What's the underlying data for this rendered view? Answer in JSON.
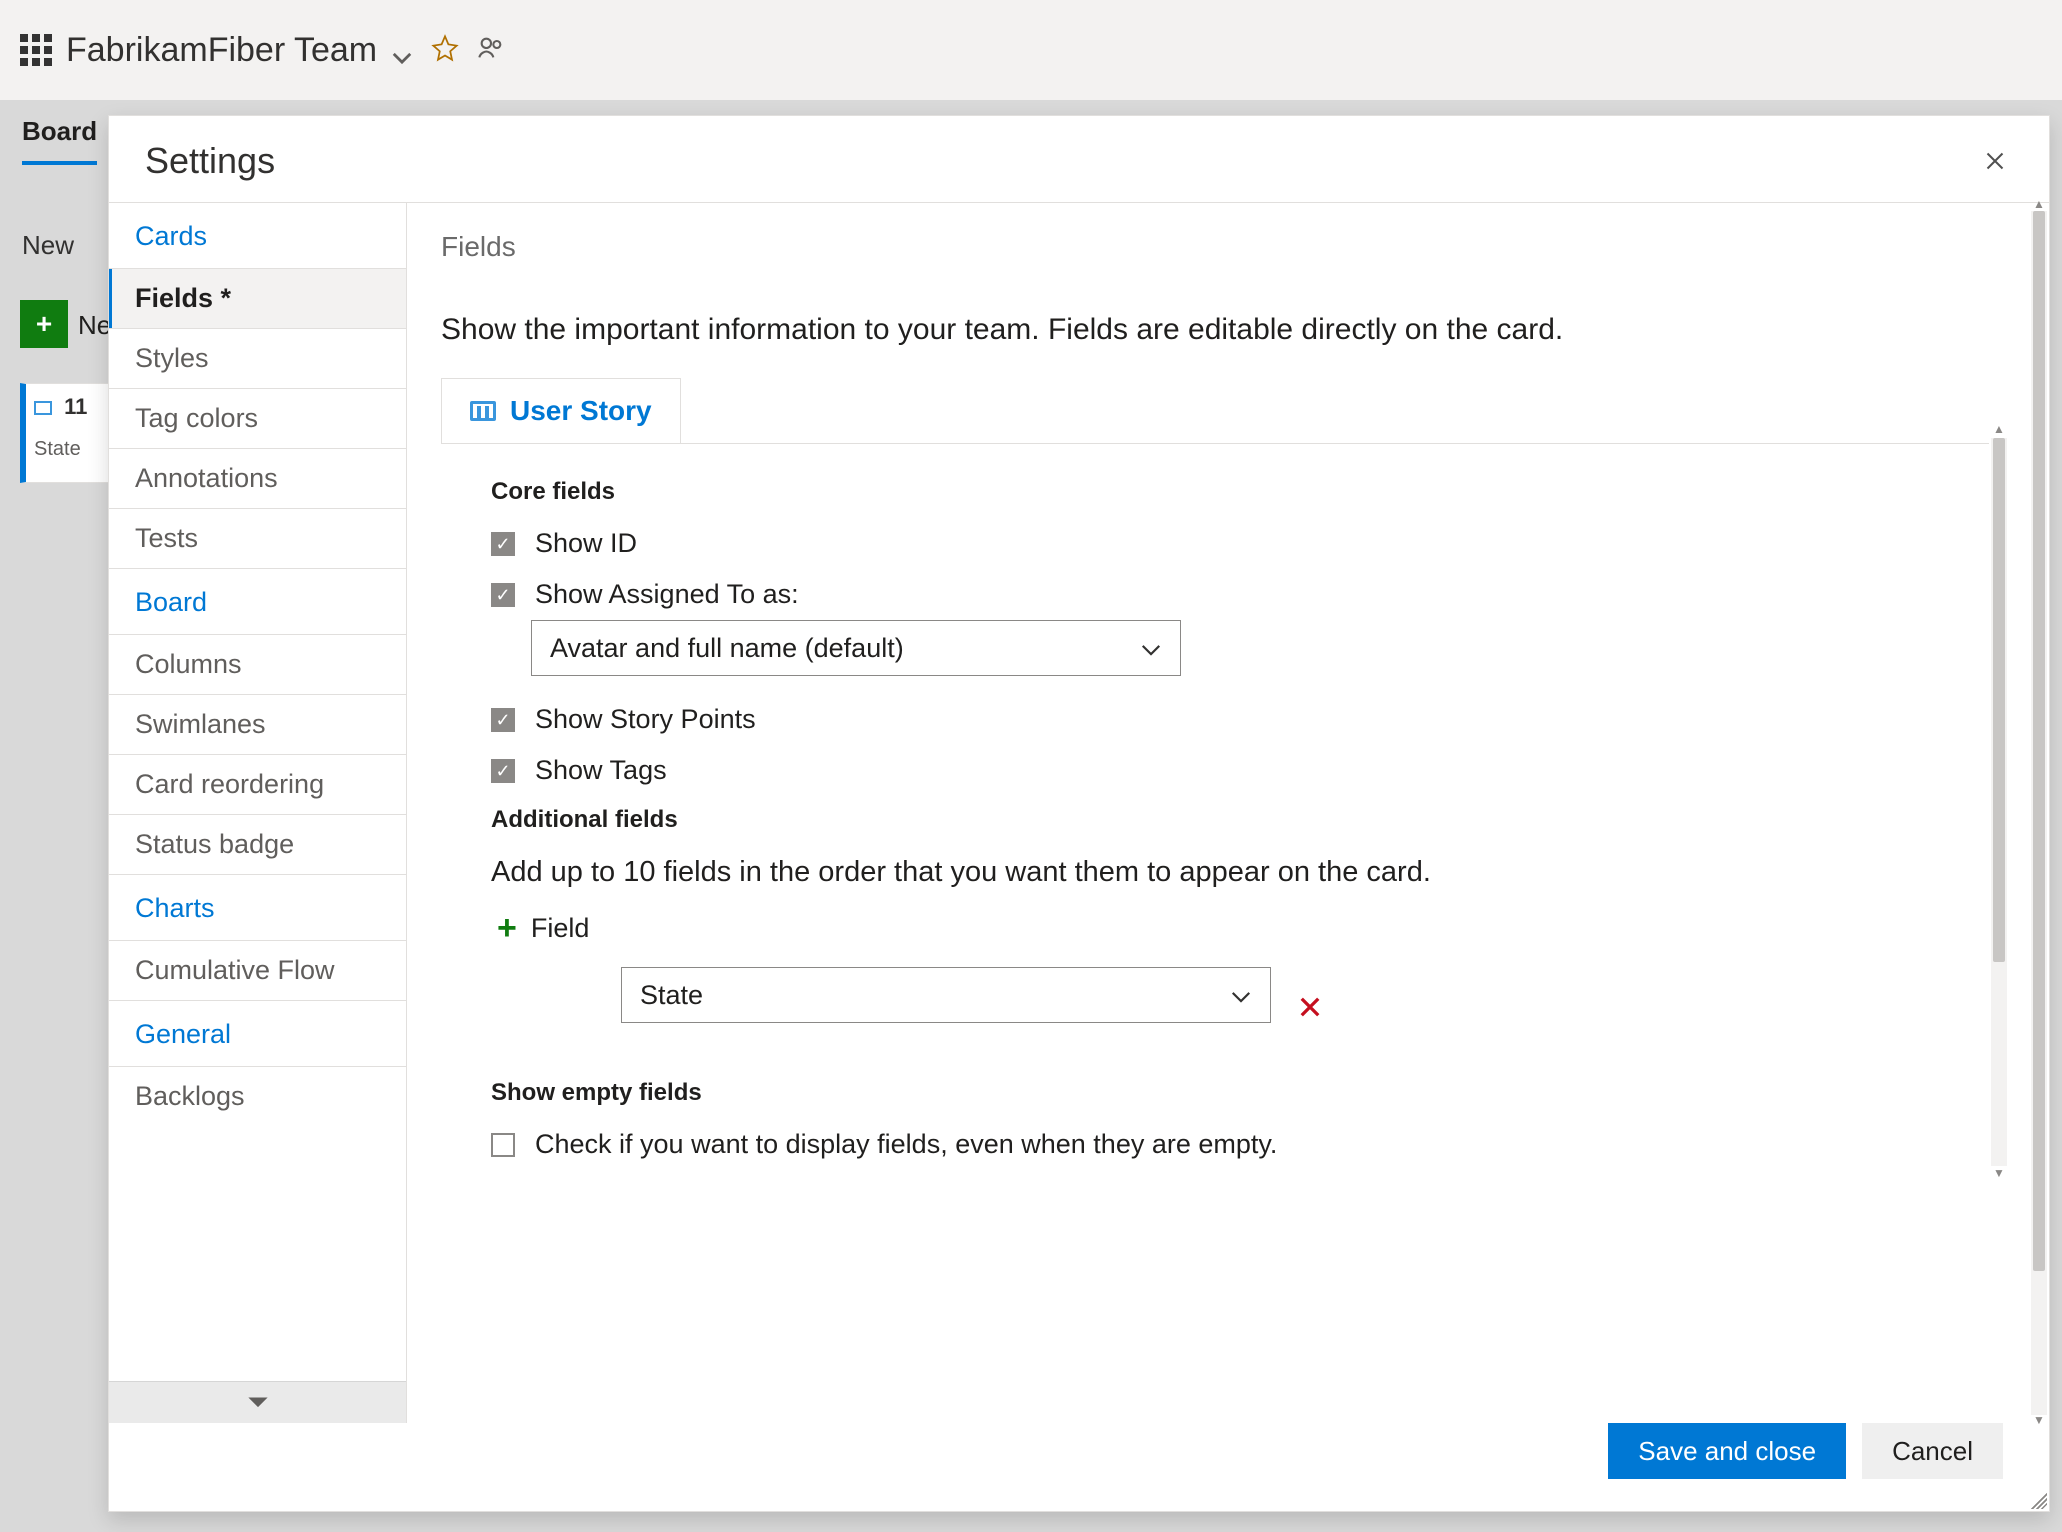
{
  "background": {
    "team_name": "FabrikamFiber Team",
    "tab": "Board",
    "column_new": "New",
    "new_item_label": "Ne",
    "card_id": "11",
    "card_state_label": "State"
  },
  "modal": {
    "title": "Settings",
    "nav": {
      "groups": [
        {
          "header": "Cards",
          "items": [
            {
              "label": "Fields *",
              "active": true
            },
            {
              "label": "Styles"
            },
            {
              "label": "Tag colors"
            },
            {
              "label": "Annotations"
            },
            {
              "label": "Tests"
            }
          ]
        },
        {
          "header": "Board",
          "items": [
            {
              "label": "Columns"
            },
            {
              "label": "Swimlanes"
            },
            {
              "label": "Card reordering"
            },
            {
              "label": "Status badge"
            }
          ]
        },
        {
          "header": "Charts",
          "items": [
            {
              "label": "Cumulative Flow"
            }
          ]
        },
        {
          "header": "General",
          "items": [
            {
              "label": "Backlogs"
            }
          ]
        }
      ]
    },
    "panel": {
      "title": "Fields",
      "description": "Show the important information to your team. Fields are editable directly on the card.",
      "wit_tab": "User Story",
      "core_fields_label": "Core fields",
      "show_id": "Show ID",
      "show_assigned": "Show Assigned To as:",
      "assigned_select": "Avatar and full name (default)",
      "show_story_points": "Show Story Points",
      "show_tags": "Show Tags",
      "additional_fields_label": "Additional fields",
      "additional_fields_desc": "Add up to 10 fields in the order that you want them to appear on the card.",
      "add_field_label": "Field",
      "added_field_select": "State",
      "show_empty_label": "Show empty fields",
      "show_empty_desc": "Check if you want to display fields, even when they are empty."
    },
    "buttons": {
      "save": "Save and close",
      "cancel": "Cancel"
    }
  }
}
